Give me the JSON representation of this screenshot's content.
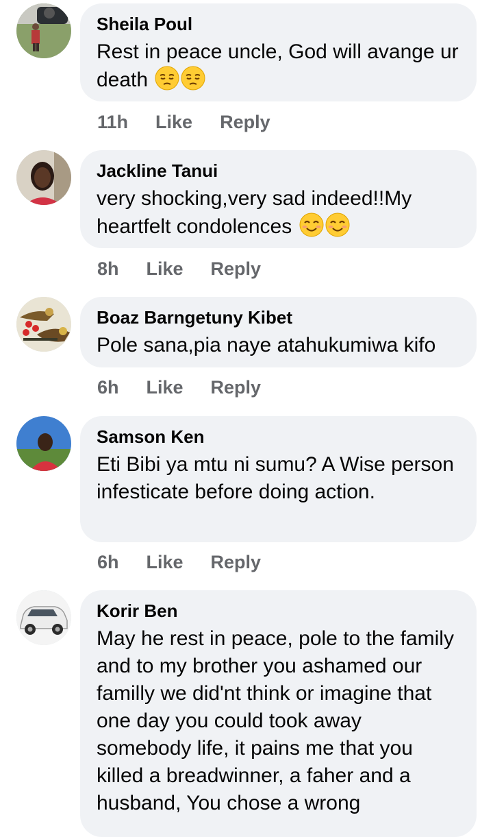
{
  "comments": [
    {
      "author": "Sheila Poul",
      "text": "Rest in peace uncle, God will avange ur death",
      "emoji": [
        "pensive-face",
        "pensive-face"
      ],
      "time": "11h",
      "like": "Like",
      "reply": "Reply"
    },
    {
      "author": "Jackline Tanui",
      "text": "very shocking,very sad indeed!!My heartfelt condolences",
      "emoji": [
        "smiling-face",
        "smiling-face"
      ],
      "time": "8h",
      "like": "Like",
      "reply": "Reply"
    },
    {
      "author": "Boaz Barngetuny Kibet",
      "text": "Pole sana,pia naye atahukumiwa kifo",
      "time": "6h",
      "like": "Like",
      "reply": "Reply"
    },
    {
      "author": "Samson Ken",
      "text": "Eti Bibi ya mtu ni sumu? A Wise person infesticate before doing action.",
      "time": "6h",
      "like": "Like",
      "reply": "Reply"
    },
    {
      "author": "Korir Ben",
      "text": "May he rest in peace, pole to the family and to my brother you ashamed our familly we did'nt think or imagine that one day you could took away somebody life, it pains me that you killed a breadwinner, a faher and a husband, You chose a wrong"
    }
  ],
  "colors": {
    "bubble": "#f0f2f5",
    "action_text": "#65676b",
    "emoji_yellow": "#ffcc33"
  }
}
